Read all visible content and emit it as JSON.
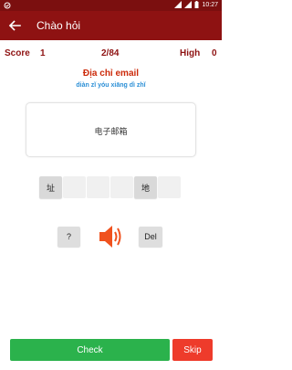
{
  "status_bar": {
    "time": "10:27"
  },
  "app_bar": {
    "title": "Chào hỏi"
  },
  "score": {
    "score_label": "Score",
    "score_value": "1",
    "progress": "2/84",
    "high_label": "High",
    "high_value": "0"
  },
  "question": {
    "word": "Địa chỉ email",
    "pinyin": "diàn zǐ yóu xiāng dì zhǐ",
    "hanzi": "电子邮箱"
  },
  "answer_slots": [
    "址",
    "",
    "",
    "",
    "地",
    ""
  ],
  "controls": {
    "hint_label": "?",
    "del_label": "Del"
  },
  "buttons": {
    "check_label": "Check",
    "skip_label": "Skip"
  },
  "colors": {
    "app_bar": "#8e1212",
    "accent_red": "#cc2a0a",
    "pinyin_blue": "#2b8fd6",
    "check_green": "#2bb24c",
    "skip_red": "#ee3b2b",
    "speaker_orange": "#f0521e"
  }
}
